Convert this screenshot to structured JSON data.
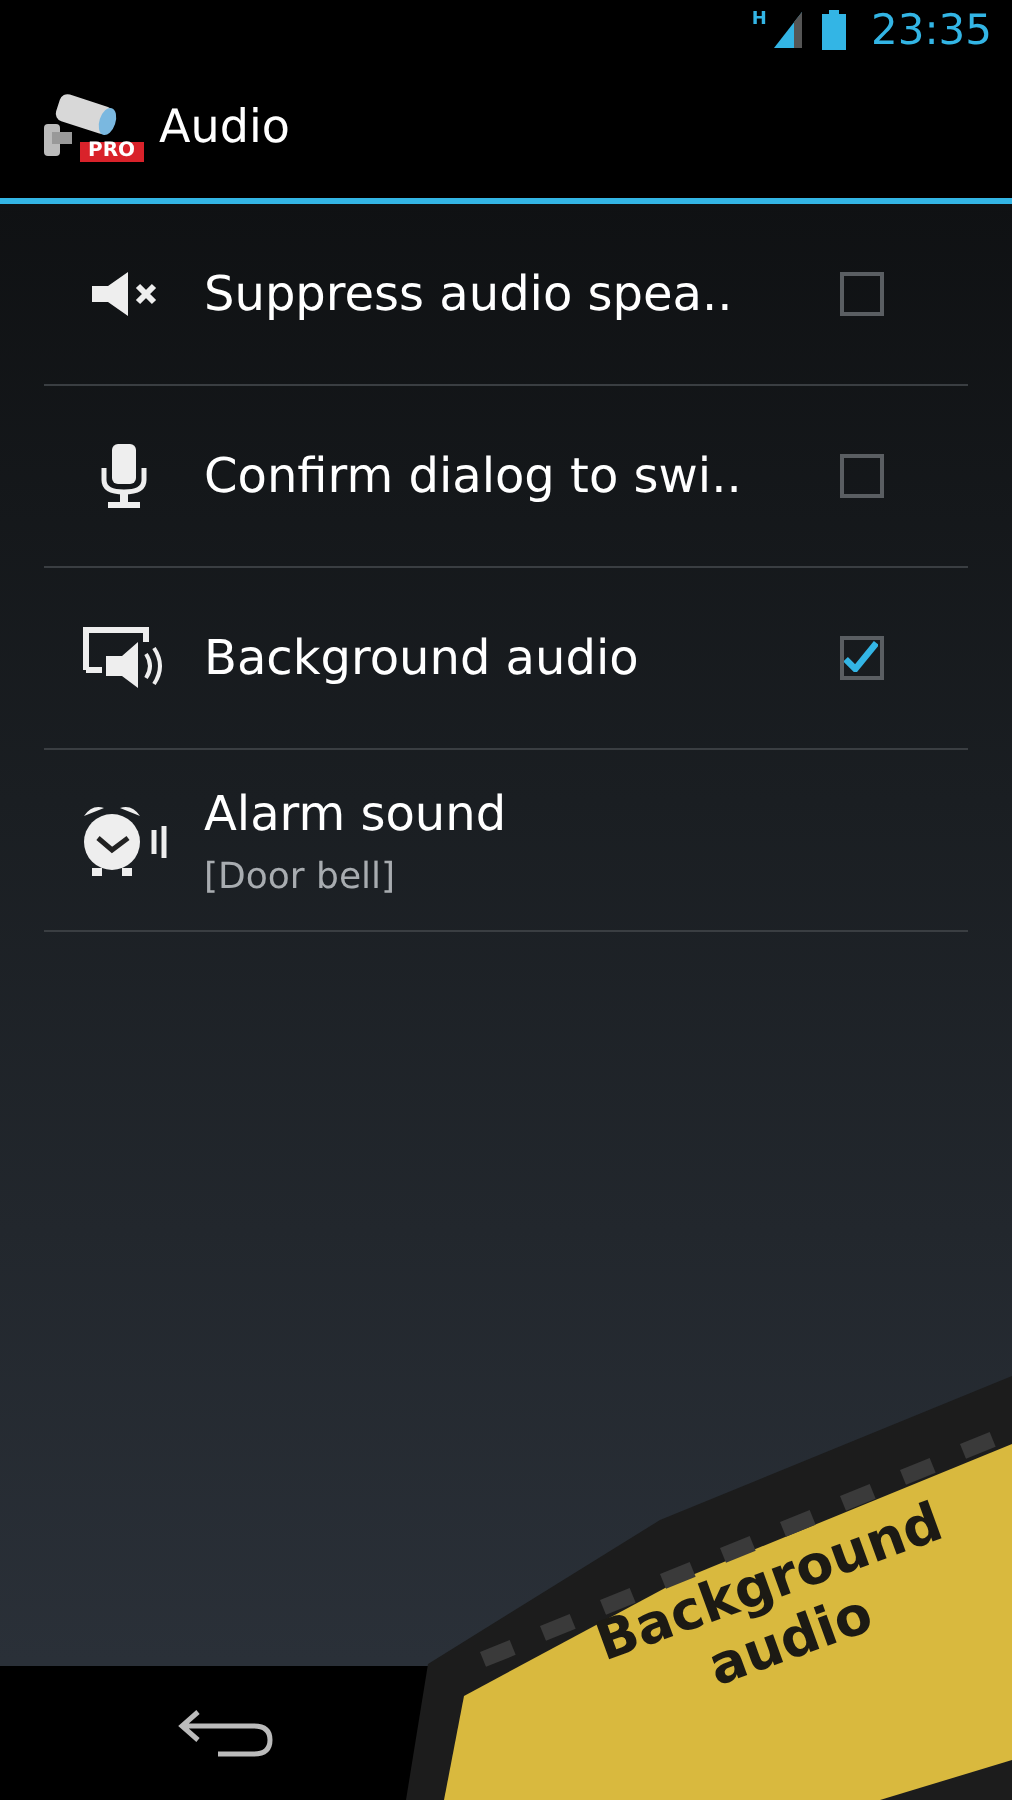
{
  "status_bar": {
    "network": "H",
    "time": "23:35"
  },
  "action_bar": {
    "title": "Audio",
    "badge": "PRO"
  },
  "settings": [
    {
      "kind": "checkbox",
      "title": "Suppress audio spea..",
      "checked": false
    },
    {
      "kind": "checkbox",
      "title": "Confirm dialog to swi..",
      "checked": false
    },
    {
      "kind": "checkbox",
      "title": "Background audio",
      "checked": true
    },
    {
      "kind": "list",
      "title": "Alarm sound",
      "summary": "[Door bell]"
    }
  ],
  "promo_ribbon": {
    "lines": [
      "Background",
      "audio"
    ]
  }
}
